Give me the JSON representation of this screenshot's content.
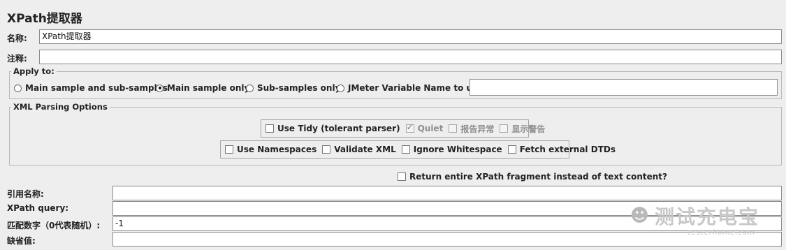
{
  "header": {
    "title": "XPath提取器"
  },
  "name_row": {
    "label": "名称:",
    "value": "XPath提取器"
  },
  "comment_row": {
    "label": "注释:",
    "value": ""
  },
  "apply_to": {
    "title": "Apply to:",
    "options": [
      {
        "label": "Main sample and sub-samples",
        "selected": false
      },
      {
        "label": "Main sample only",
        "selected": true
      },
      {
        "label": "Sub-samples only",
        "selected": false
      },
      {
        "label": "JMeter Variable Name to use",
        "selected": false
      }
    ],
    "variable_value": ""
  },
  "xml_parsing": {
    "title": "XML Parsing Options",
    "row1": [
      {
        "label": "Use Tidy (tolerant parser)",
        "checked": false,
        "enabled": true
      },
      {
        "label": "Quiet",
        "checked": true,
        "enabled": false
      },
      {
        "label": "报告异常",
        "checked": false,
        "enabled": false
      },
      {
        "label": "显示警告",
        "checked": false,
        "enabled": false
      }
    ],
    "row2": [
      {
        "label": "Use Namespaces",
        "checked": false,
        "enabled": true
      },
      {
        "label": "Validate XML",
        "checked": false,
        "enabled": true
      },
      {
        "label": "Ignore Whitespace",
        "checked": false,
        "enabled": true
      },
      {
        "label": "Fetch external DTDs",
        "checked": false,
        "enabled": true
      }
    ]
  },
  "return_fragment": {
    "label": "Return entire XPath fragment instead of text content?",
    "checked": false
  },
  "fields": [
    {
      "label": "引用名称:",
      "value": ""
    },
    {
      "label": "XPath query:",
      "value": ""
    },
    {
      "label": "匹配数字（0代表随机）:",
      "value": "-1"
    },
    {
      "label": "缺省值:",
      "value": ""
    }
  ],
  "watermark": {
    "text": "测试充电宝",
    "url": "testerhome.com"
  },
  "colors": {
    "background": "#eeeeee",
    "border": "#b8b8b8",
    "disabled_text": "#8e8e8e"
  }
}
